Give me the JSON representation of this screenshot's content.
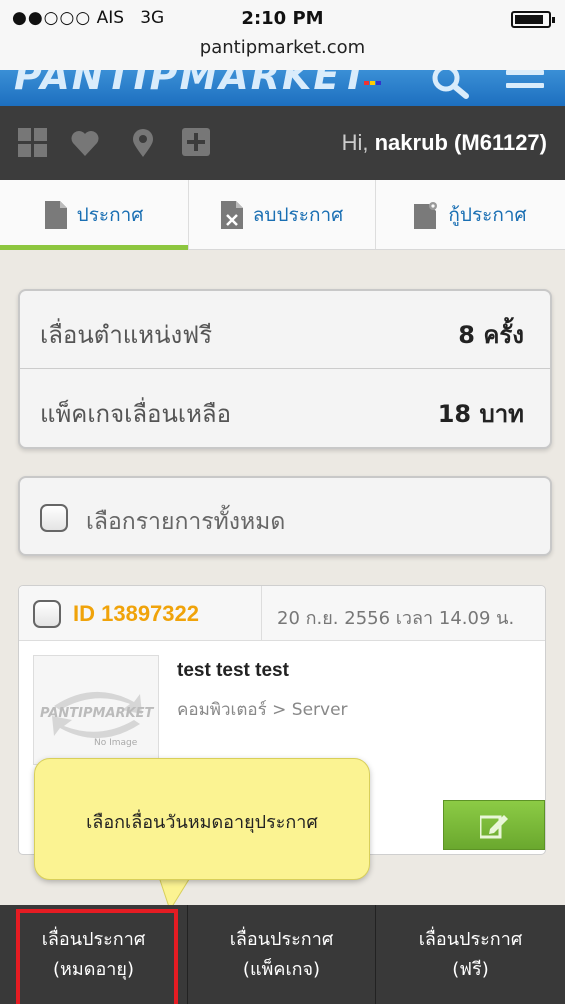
{
  "status_bar": {
    "signal": "●●○○○",
    "carrier": "AIS",
    "network": "3G",
    "time": "2:10 PM",
    "url": "pantipmarket.com"
  },
  "brand": {
    "logo_text": "PANTIPMARKET"
  },
  "user_bar": {
    "greeting": "Hi,",
    "username": "nakrub (M61127)",
    "icons": [
      "grid-icon",
      "heart-icon",
      "location-pin-icon",
      "plus-icon"
    ]
  },
  "tabs": [
    {
      "label": "ประกาศ",
      "icon": "document-icon",
      "active": true
    },
    {
      "label": "ลบประกาศ",
      "icon": "delete-document-icon",
      "active": false
    },
    {
      "label": "กู้ประกาศ",
      "icon": "restore-document-icon",
      "active": false
    }
  ],
  "stats": [
    {
      "label": "เลื่อนตำแหน่งฟรี",
      "value": "8 ครั้ง"
    },
    {
      "label": "แพ็คเกจเลื่อนเหลือ",
      "value": "18 บาท"
    }
  ],
  "select_all": {
    "label": "เลือกรายการทั้งหมด"
  },
  "listing": {
    "id": "ID 13897322",
    "date": "20 ก.ย. 2556 เวลา 14.09 น.",
    "title": "test test test",
    "category": "คอมพิวเตอร์ > Server",
    "thumb_logo": "PANTIPMARKET",
    "thumb_caption": "No Image"
  },
  "tooltip": {
    "text": "เลือกเลื่อนวันหมดอายุประกาศ"
  },
  "bottom_bar": [
    {
      "line1": "เลื่อนประกาศ",
      "line2": "(หมดอายุ)",
      "highlighted": true
    },
    {
      "line1": "เลื่อนประกาศ",
      "line2": "(แพ็คเกจ)",
      "highlighted": false
    },
    {
      "line1": "เลื่อนประกาศ",
      "line2": "(ฟรี)",
      "highlighted": false
    }
  ],
  "colors": {
    "brand_blue": "#1d6fbf",
    "tab_accent": "#8dc63f",
    "id_orange": "#f0a30a",
    "highlight_red": "#e51c23",
    "tooltip_yellow": "#fbf392"
  }
}
